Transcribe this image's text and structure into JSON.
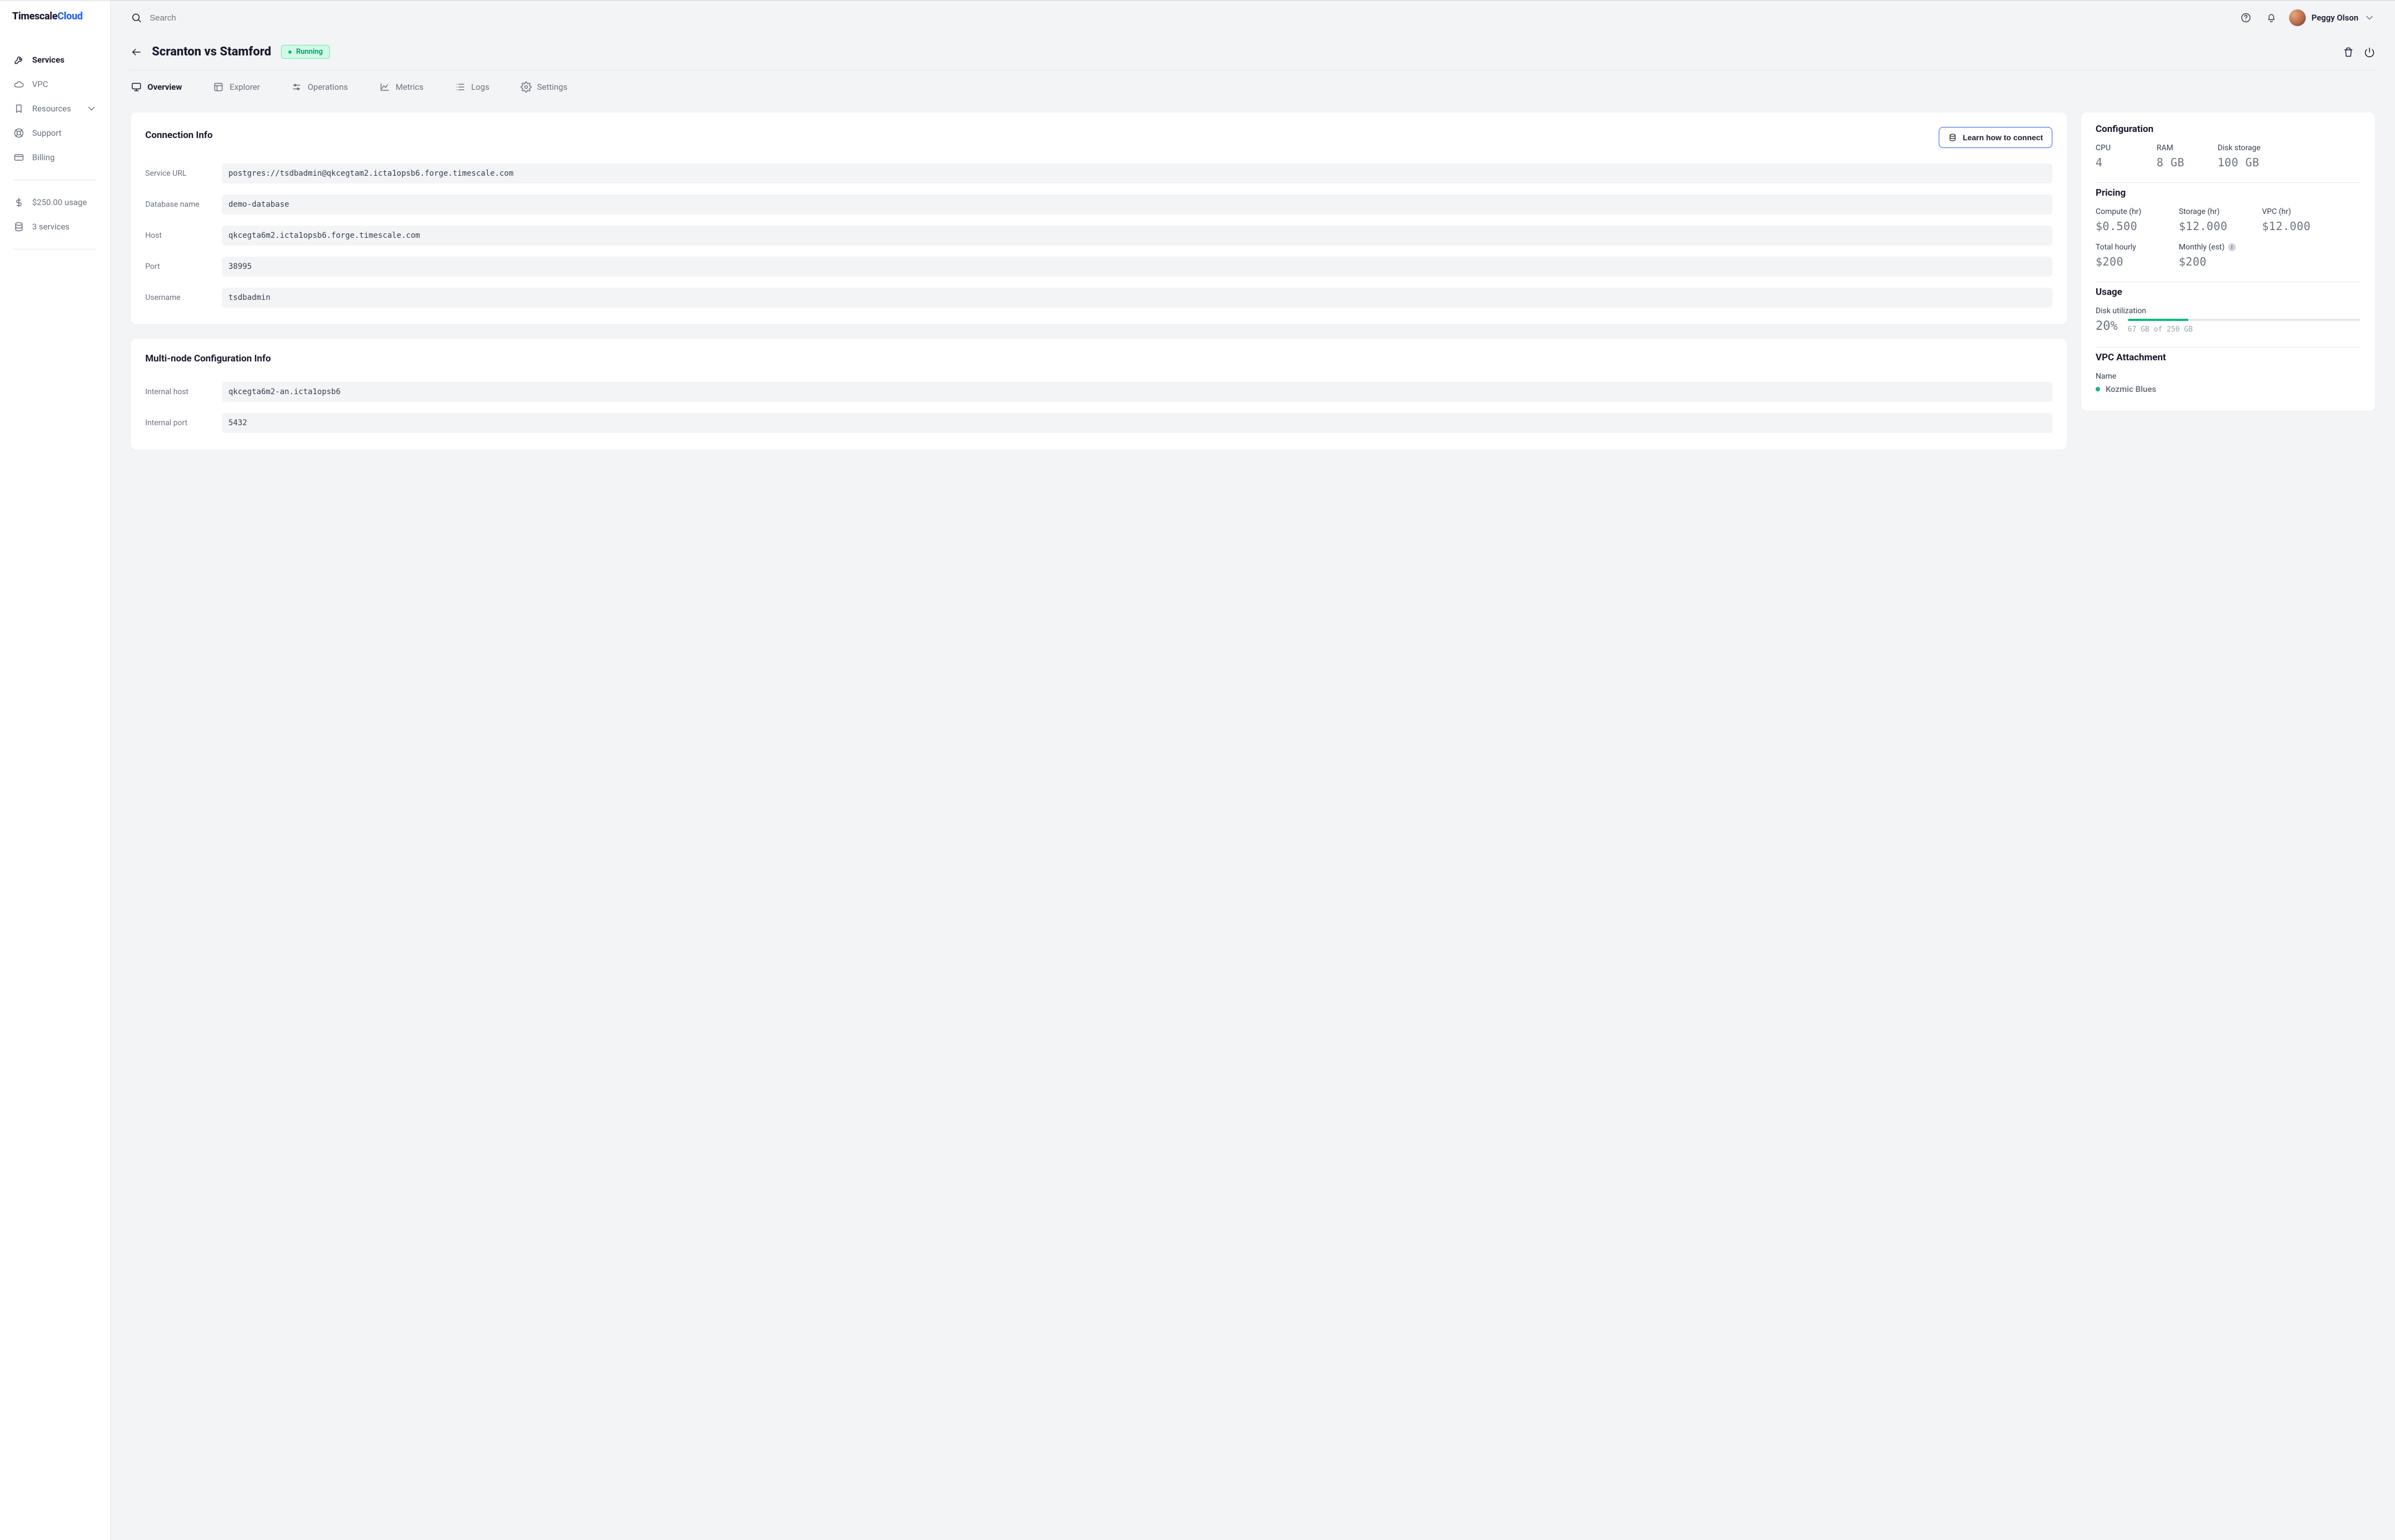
{
  "brand": {
    "part1": "Timescale",
    "part2": "Cloud"
  },
  "sidebar": {
    "items": [
      {
        "label": "Services"
      },
      {
        "label": "VPC"
      },
      {
        "label": "Resources"
      },
      {
        "label": "Support"
      },
      {
        "label": "Billing"
      }
    ],
    "usage": "$250.00 usage",
    "services_count": "3 services"
  },
  "topbar": {
    "search_placeholder": "Search",
    "user_name": "Peggy Olson"
  },
  "page": {
    "title": "Scranton vs Stamford",
    "status": "Running"
  },
  "tabs": [
    {
      "label": "Overview"
    },
    {
      "label": "Explorer"
    },
    {
      "label": "Operations"
    },
    {
      "label": "Metrics"
    },
    {
      "label": "Logs"
    },
    {
      "label": "Settings"
    }
  ],
  "connection": {
    "title": "Connection Info",
    "learn_label": "Learn how to connect",
    "fields": {
      "service_url": {
        "label": "Service URL",
        "value": "postgres://tsdbadmin@qkcegtam2.icta1opsb6.forge.timescale.com"
      },
      "db_name": {
        "label": "Database name",
        "value": "demo-database"
      },
      "host": {
        "label": "Host",
        "value": "qkcegta6m2.icta1opsb6.forge.timescale.com"
      },
      "port": {
        "label": "Port",
        "value": "38995"
      },
      "username": {
        "label": "Username",
        "value": "tsdbadmin"
      }
    }
  },
  "multinode": {
    "title": "Multi-node Configuration Info",
    "fields": {
      "internal_host": {
        "label": "Internal host",
        "value": "qkcegta6m2-an.icta1opsb6"
      },
      "internal_port": {
        "label": "Internal port",
        "value": "5432"
      }
    }
  },
  "config": {
    "title": "Configuration",
    "cpu": {
      "label": "CPU",
      "value": "4"
    },
    "ram": {
      "label": "RAM",
      "value": "8 GB"
    },
    "disk": {
      "label": "Disk storage",
      "value": "100 GB"
    }
  },
  "pricing": {
    "title": "Pricing",
    "compute": {
      "label": "Compute (hr)",
      "value": "$0.500"
    },
    "storage": {
      "label": "Storage (hr)",
      "value": "$12.000"
    },
    "vpc": {
      "label": "VPC (hr)",
      "value": "$12.000"
    },
    "total_hourly": {
      "label": "Total hourly",
      "value": "$200"
    },
    "monthly": {
      "label": "Monthly (est)",
      "value": "$200"
    }
  },
  "usage": {
    "title": "Usage",
    "label": "Disk utilization",
    "pct": "20%",
    "text": "67 GB of 250 GB"
  },
  "vpc": {
    "title": "VPC Attachment",
    "label": "Name",
    "name": "Kozmic Blues"
  }
}
